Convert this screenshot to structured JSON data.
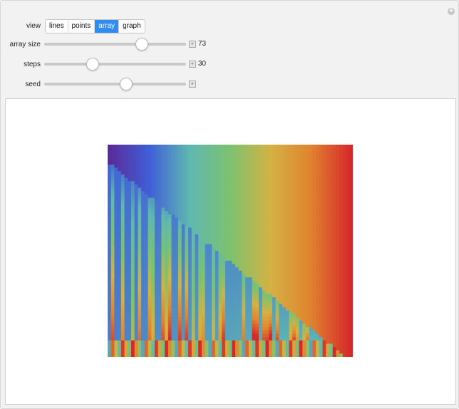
{
  "controls": {
    "view": {
      "label": "view",
      "options": [
        "lines",
        "points",
        "array",
        "graph"
      ],
      "selected": "array"
    },
    "array_size": {
      "label": "array size",
      "value": "73",
      "fraction": 0.7
    },
    "steps": {
      "label": "steps",
      "value": "30",
      "fraction": 0.32
    },
    "seed": {
      "label": "seed",
      "fraction": 0.58
    }
  },
  "array_plot": {
    "columns": 73,
    "rows": 64,
    "colormap": [
      "#5b2a9a",
      "#3f5fd8",
      "#5fb8b0",
      "#7cc26f",
      "#d4b243",
      "#e0832f",
      "#d5282a"
    ]
  },
  "colors": {
    "selected": "#2f8cf0"
  }
}
